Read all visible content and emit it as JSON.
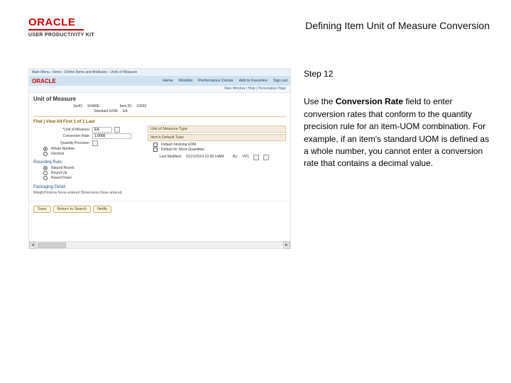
{
  "header": {
    "oracle_word": "ORACLE",
    "upk_subtitle": "USER PRODUCTIVITY KIT",
    "page_title": "Defining Item Unit of Measure Conversion"
  },
  "right": {
    "step_label": "Step 12",
    "instruction_prefix": "Use the ",
    "instruction_bold": "Conversion Rate",
    "instruction_suffix": " field to enter conversion rates that conform to the quantity precision rule for an item-UOM combination. For example, if an item's standard UOM is defined as a whole number, you cannot enter a conversion rate that contains a decimal value."
  },
  "app": {
    "topbar": "Main Menu  ›  Items  ›  Define Items and Attributes  ›  Units of Measure",
    "brand": "ORACLE",
    "nav": [
      "Home",
      "Worklist",
      "Performance Center",
      "Add to Favorites",
      "Sign out"
    ],
    "subbar": "New Window | Help | Personalize Page",
    "section_title": "Unit of Measure",
    "summary": {
      "setid_label": "SetID:",
      "setid_value": "SHARE",
      "itemid_label": "Item ID:",
      "itemid_value": "10002",
      "std_label": "Standard UOM:",
      "std_value": "EA"
    },
    "tabstrip": "Find | View All    First  1 of 1  Last",
    "left_pane": {
      "uom_label": "*Unit of Measure:",
      "uom_value": "EA",
      "convrate_label": "Conversion Rate:",
      "convrate_value": "1.0000",
      "qtyprec_label": "Quantity Precision:",
      "qtyprec_opt1": "Whole Number",
      "qtyprec_opt2": "Decimal",
      "rounding_label": "Rounding Rule:",
      "round_opt1": "Natural Round",
      "round_opt2": "Round Up",
      "round_opt3": "Round Down"
    },
    "right_pane": {
      "box1_title": "Unit of Measure Type",
      "box2_title": "Item's Default Type",
      "def_stock": "Default Stocking UOM",
      "def_order": "Default for Stock Quantities",
      "eff_label": "Last Modified:",
      "eff_value": "01/21/2014  10:38:14AM",
      "by_label": "By:",
      "by_value": "VP1"
    },
    "pack_section": "Packaging Detail",
    "pack_desc": "Weight/Volume   None entered   Dimensions   None entered",
    "buttons": [
      "Save",
      "Return to Search",
      "Notify"
    ],
    "scroll_left": "◄",
    "scroll_right": "►"
  }
}
